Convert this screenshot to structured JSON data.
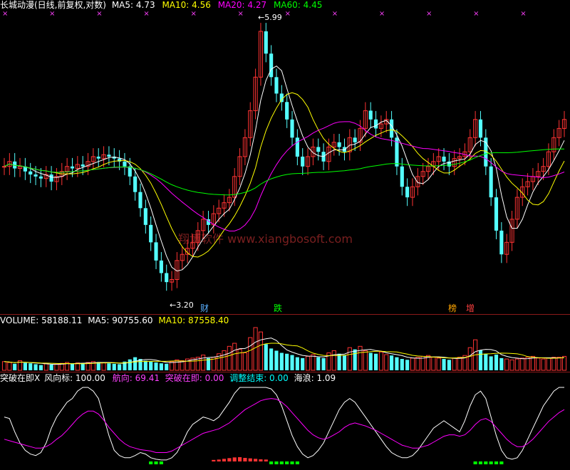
{
  "colors": {
    "white": "#ffffff",
    "yellow": "#ffff00",
    "magenta": "#ff00ff",
    "green": "#00ff00",
    "red": "#ff3333",
    "cyan": "#54ffff",
    "orange": "#ffa500",
    "pink": "#ff40ff"
  },
  "header": {
    "title": "长城动漫(日线,前复权,对数)",
    "ma5": "MA5: 4.73",
    "ma10": "MA10: 4.56",
    "ma20": "MA20: 4.27",
    "ma60": "MA60: 4.45"
  },
  "price_chart": {
    "high_marker": "5.99",
    "low_marker": "3.20",
    "event_badges": [
      "财",
      "跌",
      "榜",
      "增"
    ],
    "watermark": "翔博软件 www.xiangbosoft.com"
  },
  "volume_panel": {
    "volume": "VOLUME: 58188.11",
    "ma5": "MA5: 90755.60",
    "ma10": "MA10: 87558.40"
  },
  "indicator_panel": {
    "name": "突破在即X",
    "wind": "风向标: 100.00",
    "course": "航向: 69.41",
    "breakthrough": "突破在即: 0.00",
    "adjust_end": "调整结束: 0.00",
    "waves": "海浪: 1.09"
  },
  "chart_data": [
    {
      "type": "candlestick",
      "title": "长城动漫(日线,前复权,对数)",
      "series": [
        {
          "name": "MA5",
          "last": 4.73
        },
        {
          "name": "MA10",
          "last": 4.56
        },
        {
          "name": "MA20",
          "last": 4.27
        },
        {
          "name": "MA60",
          "last": 4.45
        }
      ],
      "annotations": [
        "5.99",
        "3.20"
      ],
      "ylim": [
        3.1,
        6.1
      ],
      "close": [
        4.3,
        4.35,
        4.28,
        4.3,
        4.25,
        4.22,
        4.2,
        4.18,
        4.22,
        4.15,
        4.2,
        4.25,
        4.3,
        4.28,
        4.32,
        4.3,
        4.35,
        4.4,
        4.38,
        4.42,
        4.4,
        4.38,
        4.35,
        4.3,
        4.2,
        4.05,
        3.9,
        3.75,
        3.6,
        3.45,
        3.35,
        3.28,
        3.3,
        3.45,
        3.5,
        3.55,
        3.6,
        3.7,
        3.8,
        3.75,
        3.85,
        3.9,
        3.95,
        4.0,
        4.2,
        4.4,
        4.6,
        4.9,
        5.3,
        5.9,
        5.6,
        5.3,
        5.1,
        5.0,
        4.8,
        4.6,
        4.4,
        4.3,
        4.4,
        4.5,
        4.45,
        4.35,
        4.5,
        4.55,
        4.5,
        4.45,
        4.6,
        4.55,
        4.7,
        4.9,
        4.8,
        4.7,
        4.75,
        4.8,
        4.6,
        4.3,
        4.1,
        4.0,
        4.1,
        4.2,
        4.25,
        4.3,
        4.35,
        4.4,
        4.35,
        4.3,
        4.38,
        4.4,
        4.45,
        4.6,
        4.8,
        4.6,
        4.3,
        4.0,
        3.7,
        3.5,
        3.6,
        3.8,
        4.0,
        4.1,
        4.15,
        4.2,
        4.25,
        4.3,
        4.45,
        4.6,
        4.7,
        4.8
      ]
    },
    {
      "type": "bar",
      "title": "VOLUME",
      "series": [
        {
          "name": "VOLUME",
          "last": 58188.11
        },
        {
          "name": "MA5",
          "last": 90755.6
        },
        {
          "name": "MA10",
          "last": 87558.4
        }
      ],
      "values": [
        20,
        18,
        15,
        22,
        17,
        16,
        14,
        12,
        15,
        13,
        14,
        16,
        18,
        15,
        17,
        16,
        18,
        20,
        19,
        17,
        16,
        15,
        14,
        20,
        25,
        30,
        26,
        22,
        20,
        18,
        16,
        15,
        20,
        24,
        22,
        26,
        28,
        30,
        35,
        28,
        30,
        38,
        45,
        55,
        62,
        48,
        40,
        75,
        98,
        88,
        60,
        50,
        45,
        40,
        38,
        35,
        30,
        28,
        32,
        36,
        30,
        28,
        40,
        45,
        38,
        35,
        52,
        48,
        55,
        45,
        40,
        38,
        42,
        36,
        34,
        30,
        26,
        24,
        28,
        30,
        32,
        34,
        30,
        28,
        26,
        24,
        28,
        30,
        34,
        52,
        70,
        46,
        38,
        32,
        36,
        28,
        26,
        24,
        26,
        28,
        30,
        32,
        28,
        26,
        28,
        30,
        30,
        32
      ]
    },
    {
      "type": "line",
      "title": "突破在即X",
      "series": [
        {
          "name": "风向标",
          "last": 100.0
        },
        {
          "name": "航向",
          "last": 69.41
        },
        {
          "name": "突破在即",
          "last": 0.0
        },
        {
          "name": "调整结束",
          "last": 0.0
        },
        {
          "name": "海浪",
          "last": 1.09
        }
      ],
      "ylim": [
        0,
        100
      ],
      "wind": [
        60,
        58,
        40,
        25,
        15,
        10,
        8,
        12,
        25,
        45,
        60,
        70,
        80,
        85,
        95,
        100,
        100,
        95,
        85,
        60,
        35,
        15,
        8,
        5,
        5,
        8,
        12,
        10,
        5,
        3,
        2,
        2,
        5,
        12,
        25,
        40,
        50,
        55,
        60,
        58,
        55,
        60,
        70,
        80,
        92,
        100,
        100,
        100,
        100,
        100,
        100,
        98,
        90,
        75,
        55,
        35,
        20,
        10,
        5,
        8,
        15,
        25,
        40,
        55,
        70,
        80,
        85,
        80,
        70,
        60,
        50,
        40,
        30,
        20,
        12,
        8,
        5,
        5,
        8,
        15,
        25,
        35,
        45,
        50,
        55,
        50,
        45,
        40,
        55,
        75,
        90,
        95,
        85,
        60,
        35,
        15,
        5,
        3,
        5,
        15,
        30,
        45,
        60,
        75,
        85,
        95,
        100,
        100
      ],
      "course": [
        30,
        28,
        26,
        24,
        22,
        20,
        18,
        18,
        20,
        24,
        30,
        35,
        42,
        50,
        58,
        64,
        68,
        68,
        64,
        56,
        46,
        38,
        30,
        24,
        20,
        18,
        16,
        15,
        14,
        12,
        12,
        12,
        14,
        18,
        22,
        26,
        30,
        34,
        38,
        40,
        42,
        44,
        48,
        52,
        58,
        64,
        70,
        74,
        78,
        82,
        84,
        85,
        84,
        80,
        74,
        66,
        58,
        50,
        42,
        36,
        32,
        30,
        32,
        36,
        40,
        46,
        50,
        52,
        50,
        48,
        45,
        42,
        38,
        34,
        30,
        26,
        22,
        20,
        18,
        18,
        20,
        22,
        26,
        30,
        34,
        36,
        36,
        34,
        36,
        42,
        50,
        56,
        58,
        54,
        46,
        38,
        30,
        24,
        20,
        20,
        24,
        30,
        38,
        46,
        54,
        60,
        66,
        70
      ]
    }
  ]
}
